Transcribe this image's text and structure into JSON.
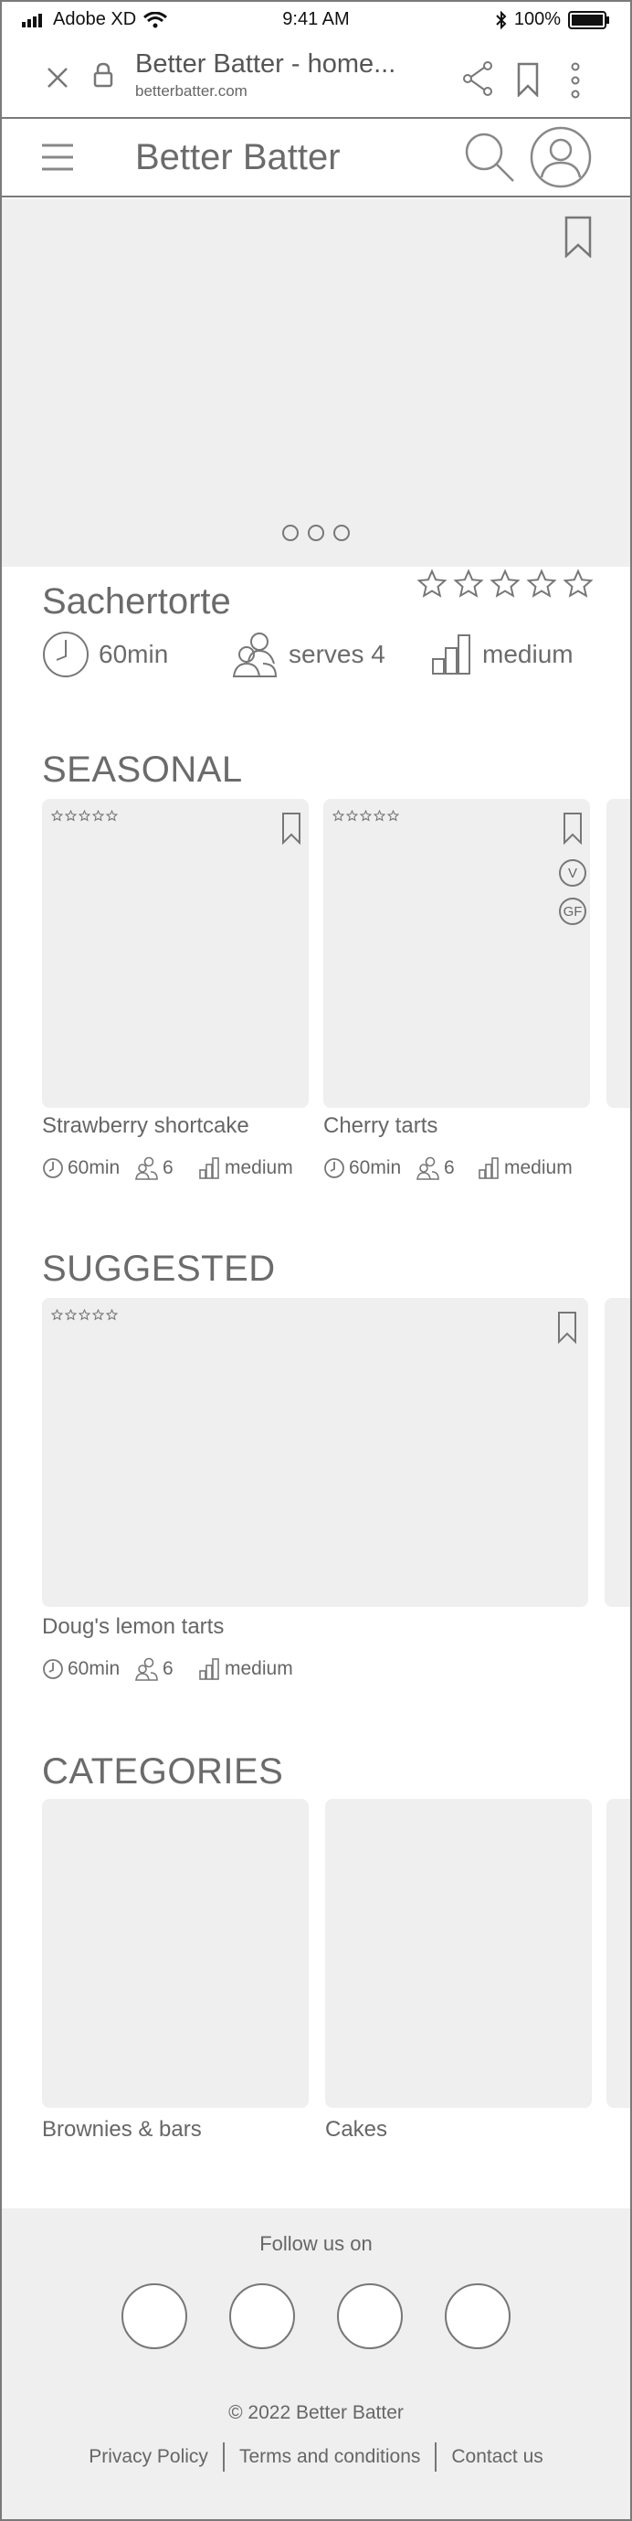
{
  "status_bar": {
    "carrier": "Adobe XD",
    "time": "9:41 AM",
    "battery": "100%"
  },
  "browser": {
    "title": "Better Batter - home...",
    "url": "betterbatter.com"
  },
  "header": {
    "brand": "Better Batter"
  },
  "featured": {
    "title": "Sachertorte",
    "time": "60min",
    "serves": "serves 4",
    "difficulty": "medium",
    "rating_stars": 5
  },
  "seasonal": {
    "title": "SEASONAL",
    "cards": [
      {
        "label": "Strawberry shortcake",
        "time": "60min",
        "serves": "6",
        "difficulty": "medium"
      },
      {
        "label": "Cherry tarts",
        "time": "60min",
        "serves": "6",
        "difficulty": "medium",
        "badges": [
          "V",
          "GF"
        ]
      }
    ]
  },
  "suggested": {
    "title": "SUGGESTED",
    "cards": [
      {
        "label": "Doug's lemon tarts",
        "time": "60min",
        "serves": "6",
        "difficulty": "medium"
      }
    ]
  },
  "categories": {
    "title": "CATEGORIES",
    "items": [
      {
        "label": "Brownies & bars"
      },
      {
        "label": "Cakes"
      }
    ]
  },
  "footer": {
    "follow": "Follow us on",
    "copyright": "© 2022 Better Batter",
    "links": [
      "Privacy Policy",
      "Terms and conditions",
      "Contact us"
    ]
  }
}
